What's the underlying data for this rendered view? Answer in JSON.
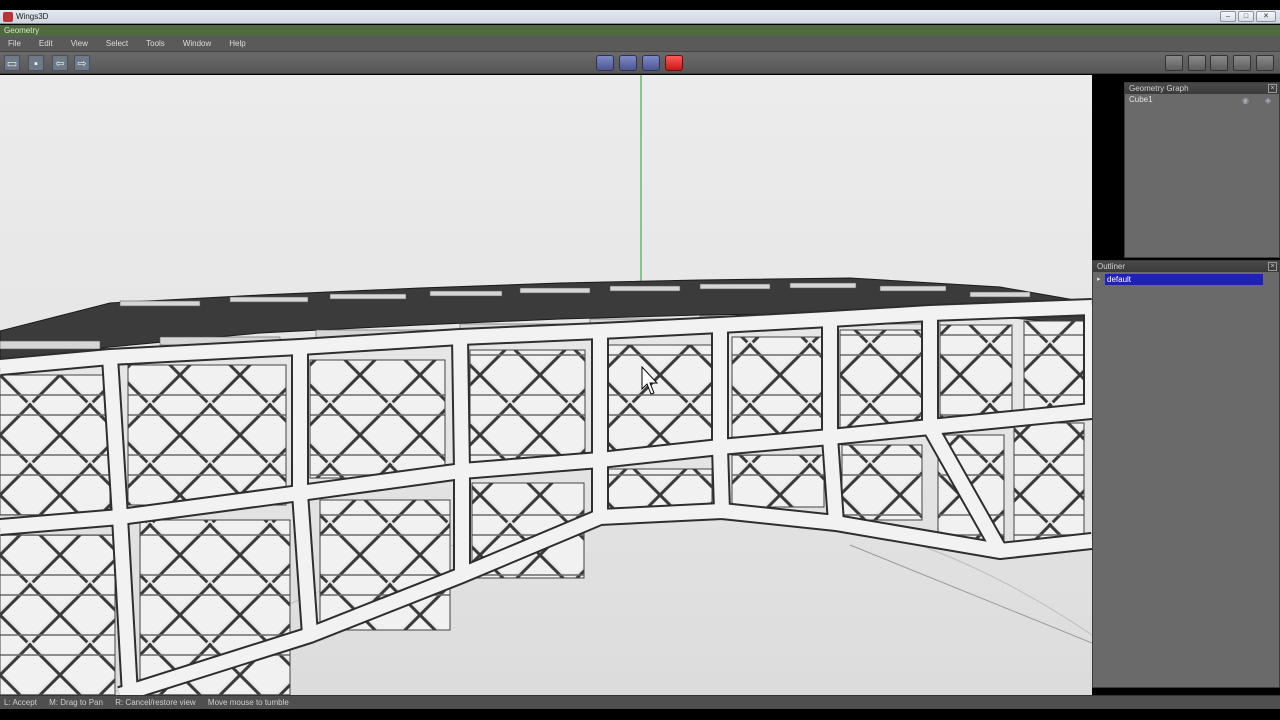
{
  "window": {
    "title": "Wings3D",
    "minimize": "–",
    "maximize": "□",
    "close": "✕"
  },
  "geometry_strip": "Geometry",
  "menu": [
    "File",
    "Edit",
    "View",
    "Select",
    "Tools",
    "Window",
    "Help"
  ],
  "toolbar": {
    "left_icons": [
      "open-icon",
      "save-icon",
      "undo-icon",
      "redo-icon"
    ],
    "selection_modes": [
      "vertex-mode",
      "edge-mode",
      "face-mode",
      "body-mode"
    ],
    "active_mode": "body-mode",
    "right_icons": [
      "grid-icon",
      "shading-icon",
      "wireframe-icon",
      "ortho-icon",
      "axes-icon"
    ]
  },
  "geometry_graph": {
    "title": "Geometry Graph",
    "items": [
      {
        "name": "Cube1"
      }
    ]
  },
  "outliner": {
    "title": "Outliner",
    "items": [
      {
        "name": "default"
      }
    ]
  },
  "status": [
    "L: Accept",
    "M: Drag to Pan",
    "R: Cancel/restore view",
    "Move mouse to tumble"
  ],
  "colors": {
    "selection_active": "#e02020",
    "outliner_highlight": "#1f22b0",
    "geometry_strip": "#4d6b3e",
    "viewport_bg": "#e6e6e6",
    "axis_green": "#3cb34a"
  }
}
